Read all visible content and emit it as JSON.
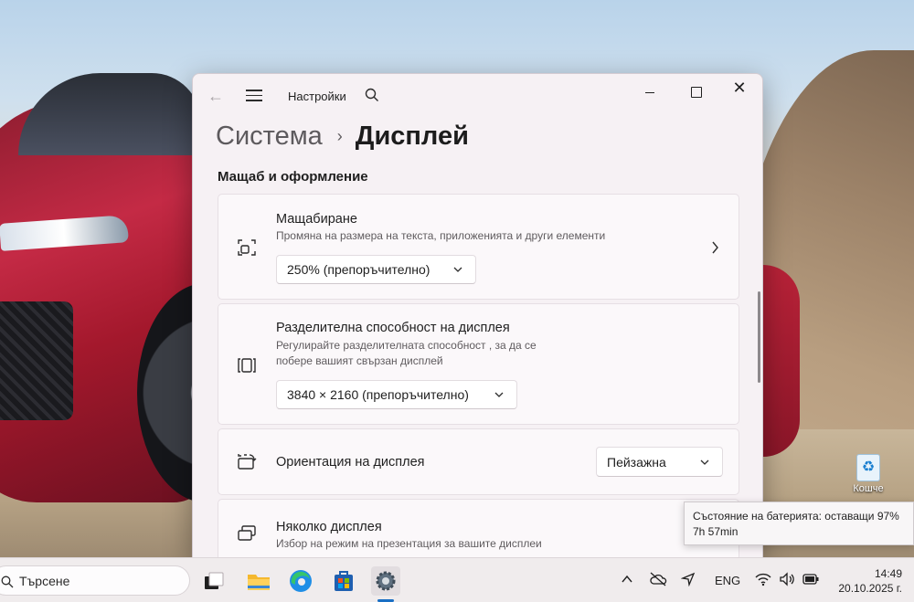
{
  "window": {
    "app_title": "Настройки",
    "breadcrumb_parent": "Система",
    "breadcrumb_current": "Дисплей",
    "section_title": "Мащаб и оформление"
  },
  "cards": {
    "scale": {
      "title": "Мащабиране",
      "description": "Промяна на размера на текста, приложенията и други елементи",
      "value": "250% (препоръчително)",
      "icon": "scale-icon"
    },
    "resolution": {
      "title": "Разделителна способност на дисплея",
      "description_line1": "Регулирайте разделителната способност , за да се",
      "description_line2": "побере вашият свързан дисплей",
      "value": "3840 × 2160 (препоръчително)",
      "icon": "resolution-icon"
    },
    "orientation": {
      "title": "Ориентация на дисплея",
      "value": "Пейзажна",
      "icon": "orientation-icon"
    },
    "multiple": {
      "title": "Няколко дисплея",
      "description": "Избор на режим на презентация за вашите дисплеи",
      "icon": "multiple-displays-icon"
    }
  },
  "tooltip": {
    "line1": "Състояние на батерията: оставащи 97%",
    "line2": "7h 57min"
  },
  "desktop": {
    "recycle_bin_label": "Кошче"
  },
  "taskbar": {
    "search_text": "Търсене",
    "language": "ENG",
    "time": "14:49",
    "date": "20.10.2025 г."
  },
  "colors": {
    "accent": "#1a6fc4",
    "window_bg": "#f6f1f4",
    "card_bg": "#fbf8fa"
  }
}
